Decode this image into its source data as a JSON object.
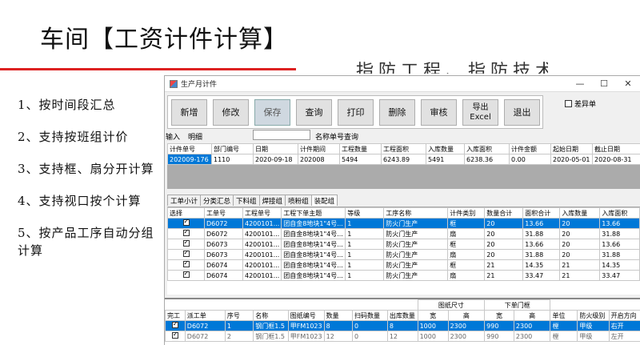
{
  "slide": {
    "title": "车间【工资计件计算】",
    "bg_text": "指防工程、指防技术、指防编辑",
    "bullets": [
      "1、按时间段汇总",
      "2、支持按班组计价",
      "3、支持框、扇分开计算",
      "4、支持视口按个计算",
      "5、按产品工序自动分组计算"
    ]
  },
  "window": {
    "title": "生产月计件",
    "controls": [
      "—",
      "☐",
      "✕"
    ]
  },
  "toolbar": {
    "buttons": [
      "新增",
      "修改",
      "保存",
      "查询",
      "打印",
      "删除",
      "审核",
      "导出Excel",
      "退出"
    ],
    "checkbox_label": "差异单"
  },
  "search": {
    "label1": "输入",
    "value1": "明细",
    "label2": "名称单号查询",
    "value2": ""
  },
  "grid1": {
    "headers": [
      "计件单号",
      "部门编号",
      "日期",
      "计件期间",
      "工程数量",
      "工程面积",
      "入库数量",
      "入库面积",
      "计件金额",
      "起始日期",
      "截止日期"
    ],
    "rows": [
      [
        "202009-176",
        "1110",
        "2020-09-18",
        "202008",
        "5494",
        "6243.89",
        "5491",
        "6238.36",
        "0.00",
        "2020-05-01",
        "2020-08-31"
      ]
    ]
  },
  "tabs": [
    "工单小计",
    "分类汇总",
    "下料组",
    "焊接组",
    "喷粉组",
    "装配组"
  ],
  "grid2": {
    "headers": [
      "选择",
      "工单号",
      "工程单号",
      "工程下单主题",
      "等级",
      "工序名称",
      "计件类别",
      "数量合计",
      "面积合计",
      "入库数量",
      "入库面积"
    ],
    "rows": [
      [
        "D6072",
        "4200101...",
        "团自金8地块1\"4号...",
        "1",
        "防火门生产",
        "框",
        "20",
        "13.66",
        "20",
        "13.66"
      ],
      [
        "D6072",
        "4200101...",
        "团自金8地块1\"4号...",
        "1",
        "防火门生产",
        "扇",
        "20",
        "31.88",
        "20",
        "31.88"
      ],
      [
        "D6073",
        "4200101...",
        "团自金8地块1\"4号...",
        "1",
        "防火门生产",
        "框",
        "20",
        "13.66",
        "20",
        "13.66"
      ],
      [
        "D6073",
        "4200101...",
        "团自金8地块1\"4号...",
        "1",
        "防火门生产",
        "扇",
        "20",
        "31.88",
        "20",
        "31.88"
      ],
      [
        "D6074",
        "4200101...",
        "团自金8地块1\"4号...",
        "1",
        "防火门生产",
        "框",
        "21",
        "14.35",
        "21",
        "14.35"
      ],
      [
        "D6074",
        "4200101...",
        "团自金8地块1\"4号...",
        "1",
        "防火门生产",
        "扇",
        "21",
        "33.47",
        "21",
        "33.47"
      ]
    ]
  },
  "grid3": {
    "group_headers": [
      "图纸尺寸",
      "下单门框"
    ],
    "headers": [
      "完工",
      "派工单",
      "序号",
      "名称",
      "图纸编号",
      "数量",
      "扫码数量",
      "出库数量",
      "宽",
      "高",
      "宽",
      "高",
      "单位",
      "防火级别",
      "开启方向"
    ],
    "rows": [
      [
        "D6072",
        "1",
        "钢门框1.5",
        "甲FM1023",
        "8",
        "0",
        "8",
        "1000",
        "2300",
        "990",
        "2300",
        "樘",
        "甲级",
        "右开"
      ],
      [
        "D6072",
        "2",
        "钢门框1.5",
        "甲FM1023",
        "12",
        "0",
        "12",
        "1000",
        "2300",
        "990",
        "2300",
        "樘",
        "甲级",
        "左开"
      ]
    ]
  }
}
